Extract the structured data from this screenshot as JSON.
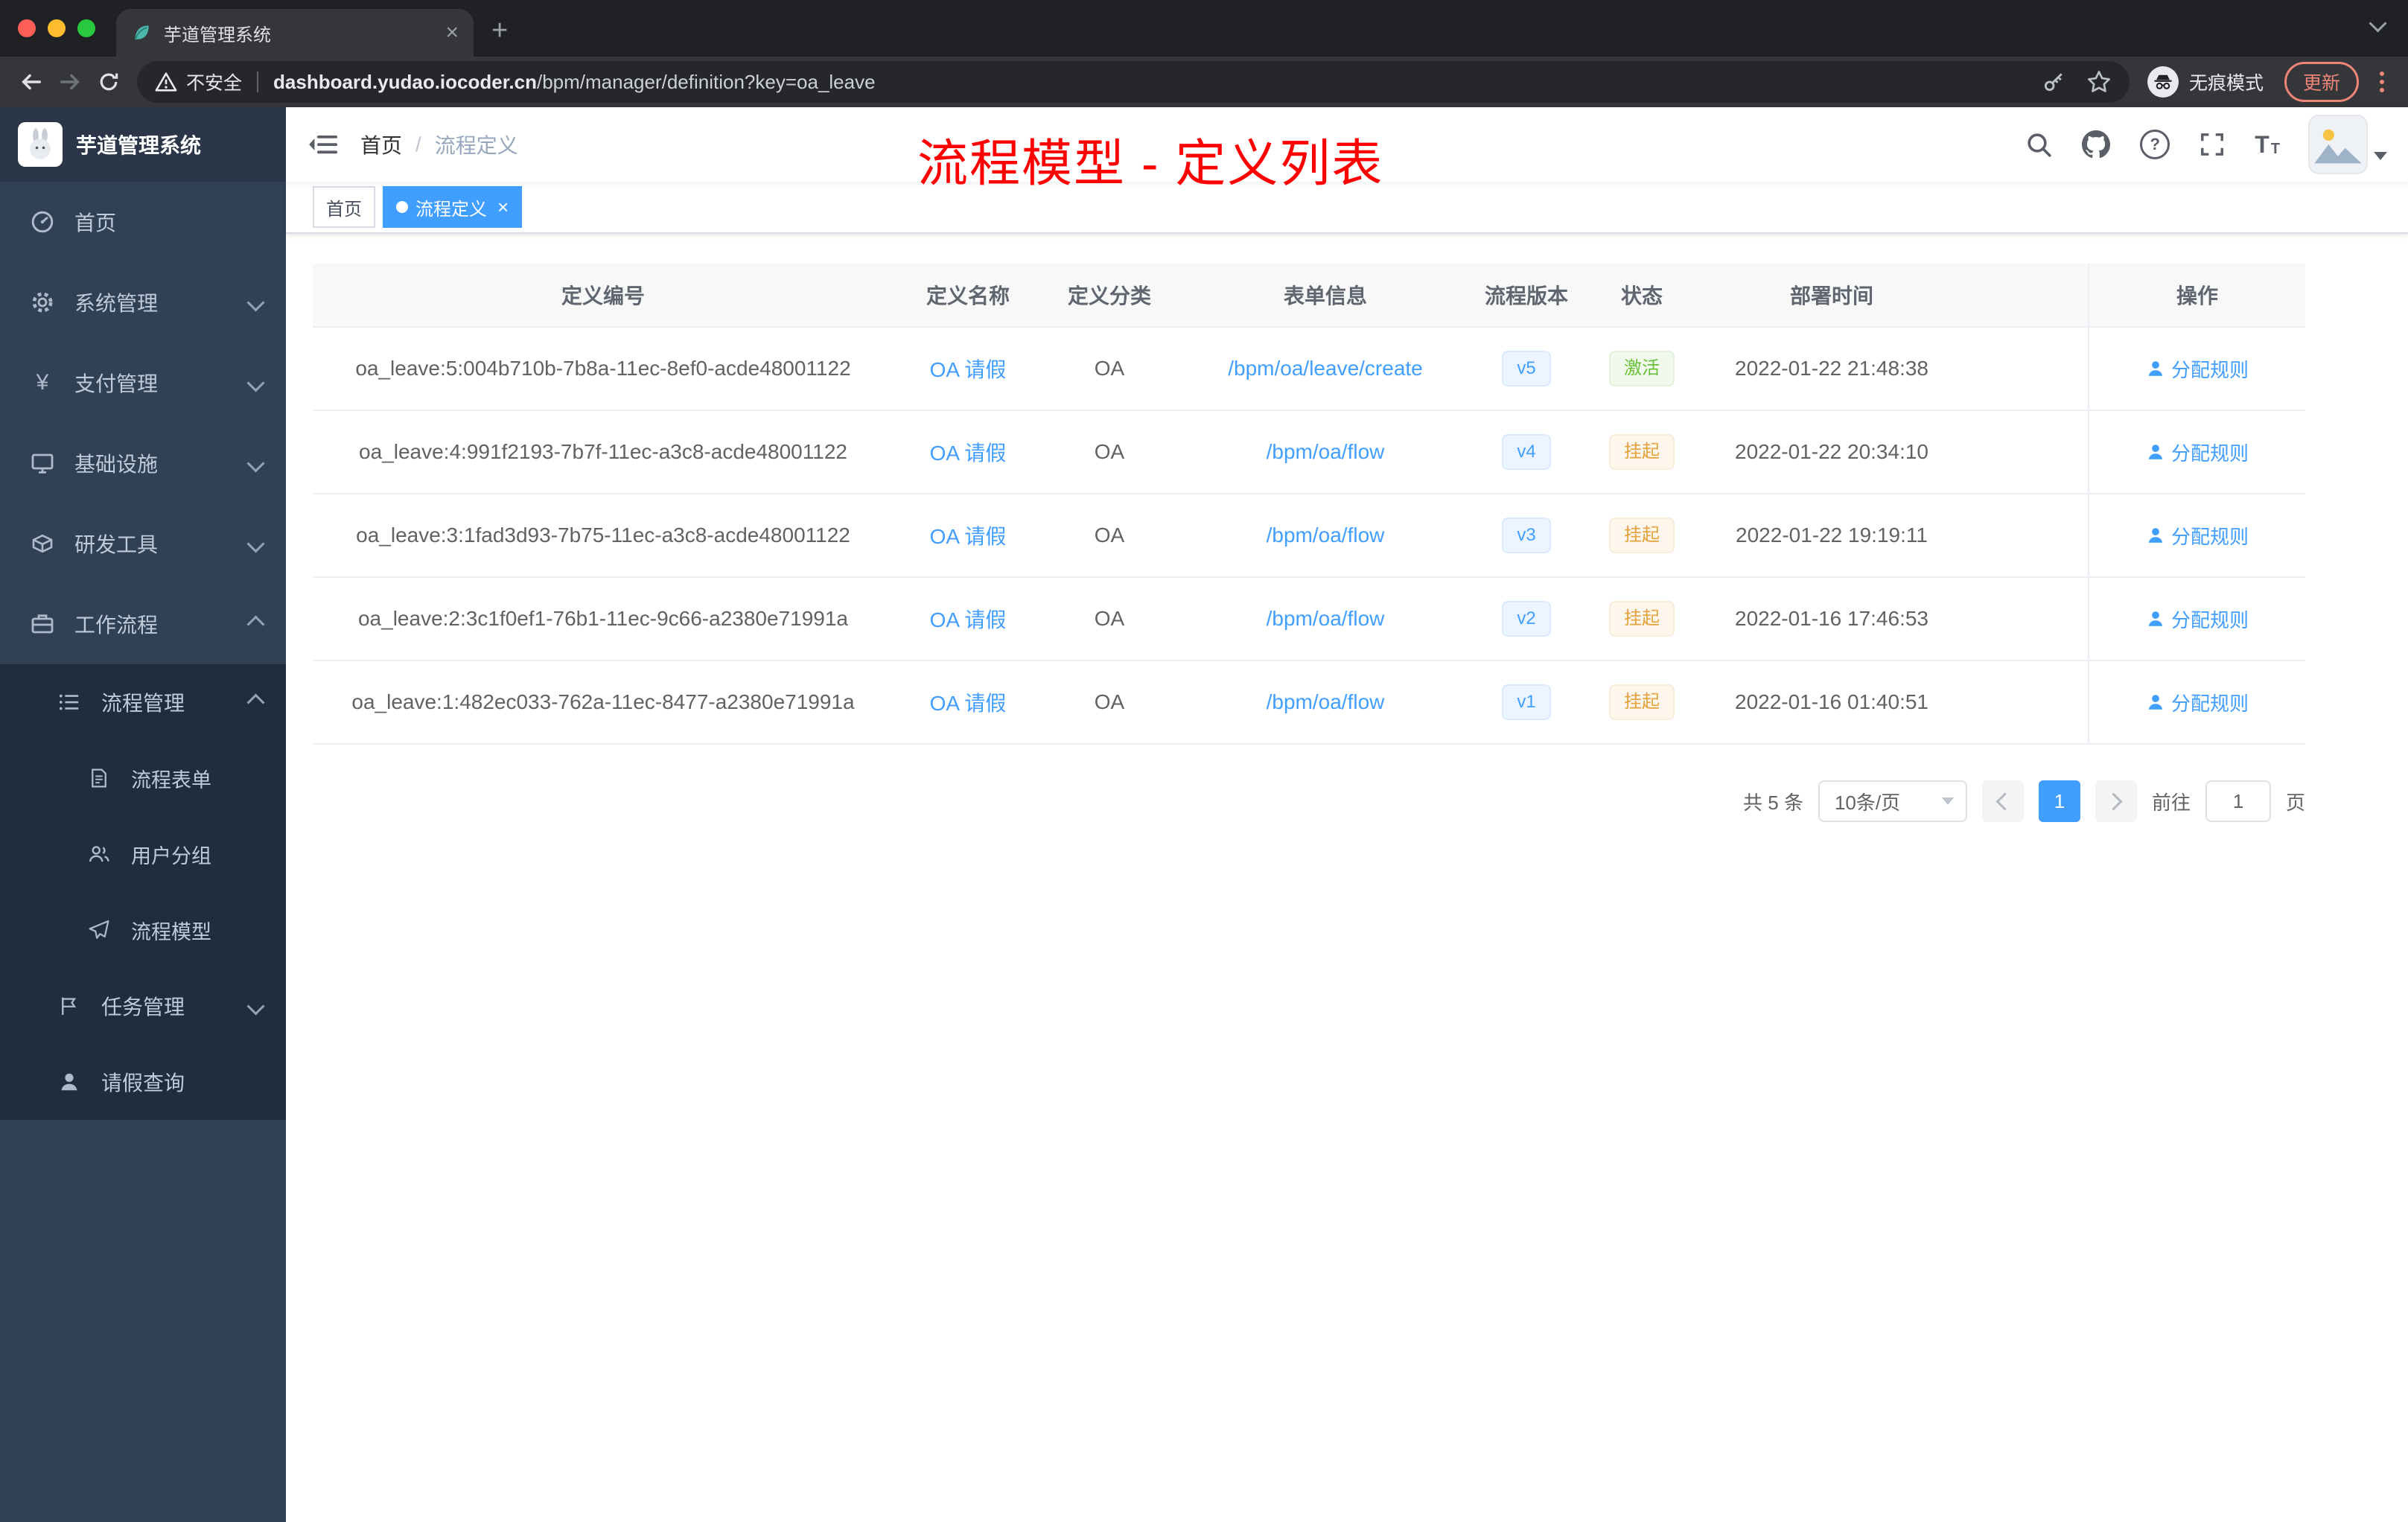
{
  "colors": {
    "primary": "#409eff",
    "success": "#67c23a",
    "warning": "#e6a23c",
    "annotation_red": "#ff0000",
    "sidebar_bg": "#304156",
    "submenu_bg": "#1f2d3d"
  },
  "browser": {
    "tab": {
      "title": "芋道管理系统"
    },
    "address": {
      "security_label": "不安全",
      "domain": "dashboard.yudao.iocoder.cn",
      "path": "/bpm/manager/definition?key=oa_leave",
      "incognito_label": "无痕模式",
      "update_label": "更新"
    }
  },
  "sidebar": {
    "logo_title": "芋道管理系统",
    "menu": {
      "home": "首页",
      "system": "系统管理",
      "payment": "支付管理",
      "infra": "基础设施",
      "devtools": "研发工具",
      "workflow": "工作流程",
      "process_mgmt": "流程管理",
      "process_form": "流程表单",
      "user_group": "用户分组",
      "process_model": "流程模型",
      "task_mgmt": "任务管理",
      "leave_query": "请假查询"
    }
  },
  "navbar": {
    "breadcrumb_home": "首页",
    "breadcrumb_current": "流程定义"
  },
  "annotation": "流程模型 - 定义列表",
  "tags_view": {
    "tags": [
      {
        "label": "首页",
        "active": false
      },
      {
        "label": "流程定义",
        "active": true
      }
    ]
  },
  "table": {
    "columns": [
      "定义编号",
      "定义名称",
      "定义分类",
      "表单信息",
      "流程版本",
      "状态",
      "部署时间",
      "操作"
    ],
    "action_label": "分配规则",
    "rows": [
      {
        "id": "oa_leave:5:004b710b-7b8a-11ec-8ef0-acde48001122",
        "name": "OA 请假",
        "category": "OA",
        "form": "/bpm/oa/leave/create",
        "version": "v5",
        "status": "激活",
        "status_type": "success",
        "deploy_time": "2022-01-22 21:48:38"
      },
      {
        "id": "oa_leave:4:991f2193-7b7f-11ec-a3c8-acde48001122",
        "name": "OA 请假",
        "category": "OA",
        "form": "/bpm/oa/flow",
        "version": "v4",
        "status": "挂起",
        "status_type": "warning",
        "deploy_time": "2022-01-22 20:34:10"
      },
      {
        "id": "oa_leave:3:1fad3d93-7b75-11ec-a3c8-acde48001122",
        "name": "OA 请假",
        "category": "OA",
        "form": "/bpm/oa/flow",
        "version": "v3",
        "status": "挂起",
        "status_type": "warning",
        "deploy_time": "2022-01-22 19:19:11"
      },
      {
        "id": "oa_leave:2:3c1f0ef1-76b1-11ec-9c66-a2380e71991a",
        "name": "OA 请假",
        "category": "OA",
        "form": "/bpm/oa/flow",
        "version": "v2",
        "status": "挂起",
        "status_type": "warning",
        "deploy_time": "2022-01-16 17:46:53"
      },
      {
        "id": "oa_leave:1:482ec033-762a-11ec-8477-a2380e71991a",
        "name": "OA 请假",
        "category": "OA",
        "form": "/bpm/oa/flow",
        "version": "v1",
        "status": "挂起",
        "status_type": "warning",
        "deploy_time": "2022-01-16 01:40:51"
      }
    ]
  },
  "pagination": {
    "total": "共 5 条",
    "page_size": "10条/页",
    "current_page": "1",
    "goto_prefix": "前往",
    "goto_value": "1",
    "goto_suffix": "页"
  }
}
